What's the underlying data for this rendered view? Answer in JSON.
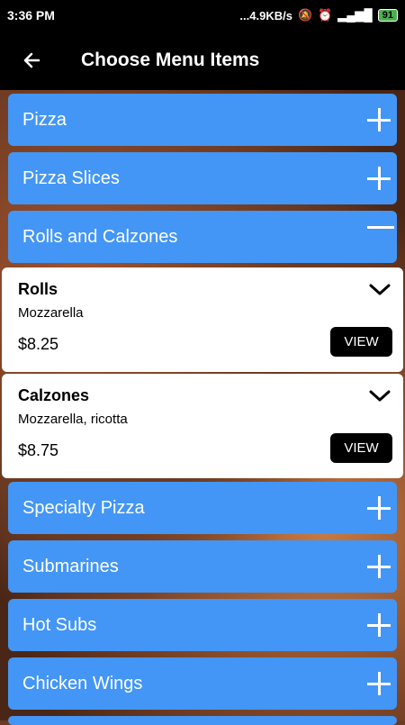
{
  "status": {
    "time": "3:36 PM",
    "net_speed": "...4.9KB/s",
    "battery": "91"
  },
  "appbar": {
    "title": "Choose Menu Items"
  },
  "categories_top": [
    {
      "label": "Pizza",
      "state": "collapsed"
    },
    {
      "label": "Pizza Slices",
      "state": "collapsed"
    },
    {
      "label": "Rolls and Calzones",
      "state": "expanded"
    }
  ],
  "items": [
    {
      "name": "Rolls",
      "description": "Mozzarella",
      "price": "$8.25",
      "button": "VIEW"
    },
    {
      "name": "Calzones",
      "description": "Mozzarella, ricotta",
      "price": "$8.75",
      "button": "VIEW"
    }
  ],
  "categories_bottom": [
    {
      "label": "Specialty Pizza",
      "state": "collapsed"
    },
    {
      "label": "Submarines",
      "state": "collapsed"
    },
    {
      "label": "Hot Subs",
      "state": "collapsed"
    },
    {
      "label": "Chicken Wings",
      "state": "collapsed"
    }
  ],
  "colors": {
    "accent": "#4396f5",
    "button": "#000000"
  }
}
